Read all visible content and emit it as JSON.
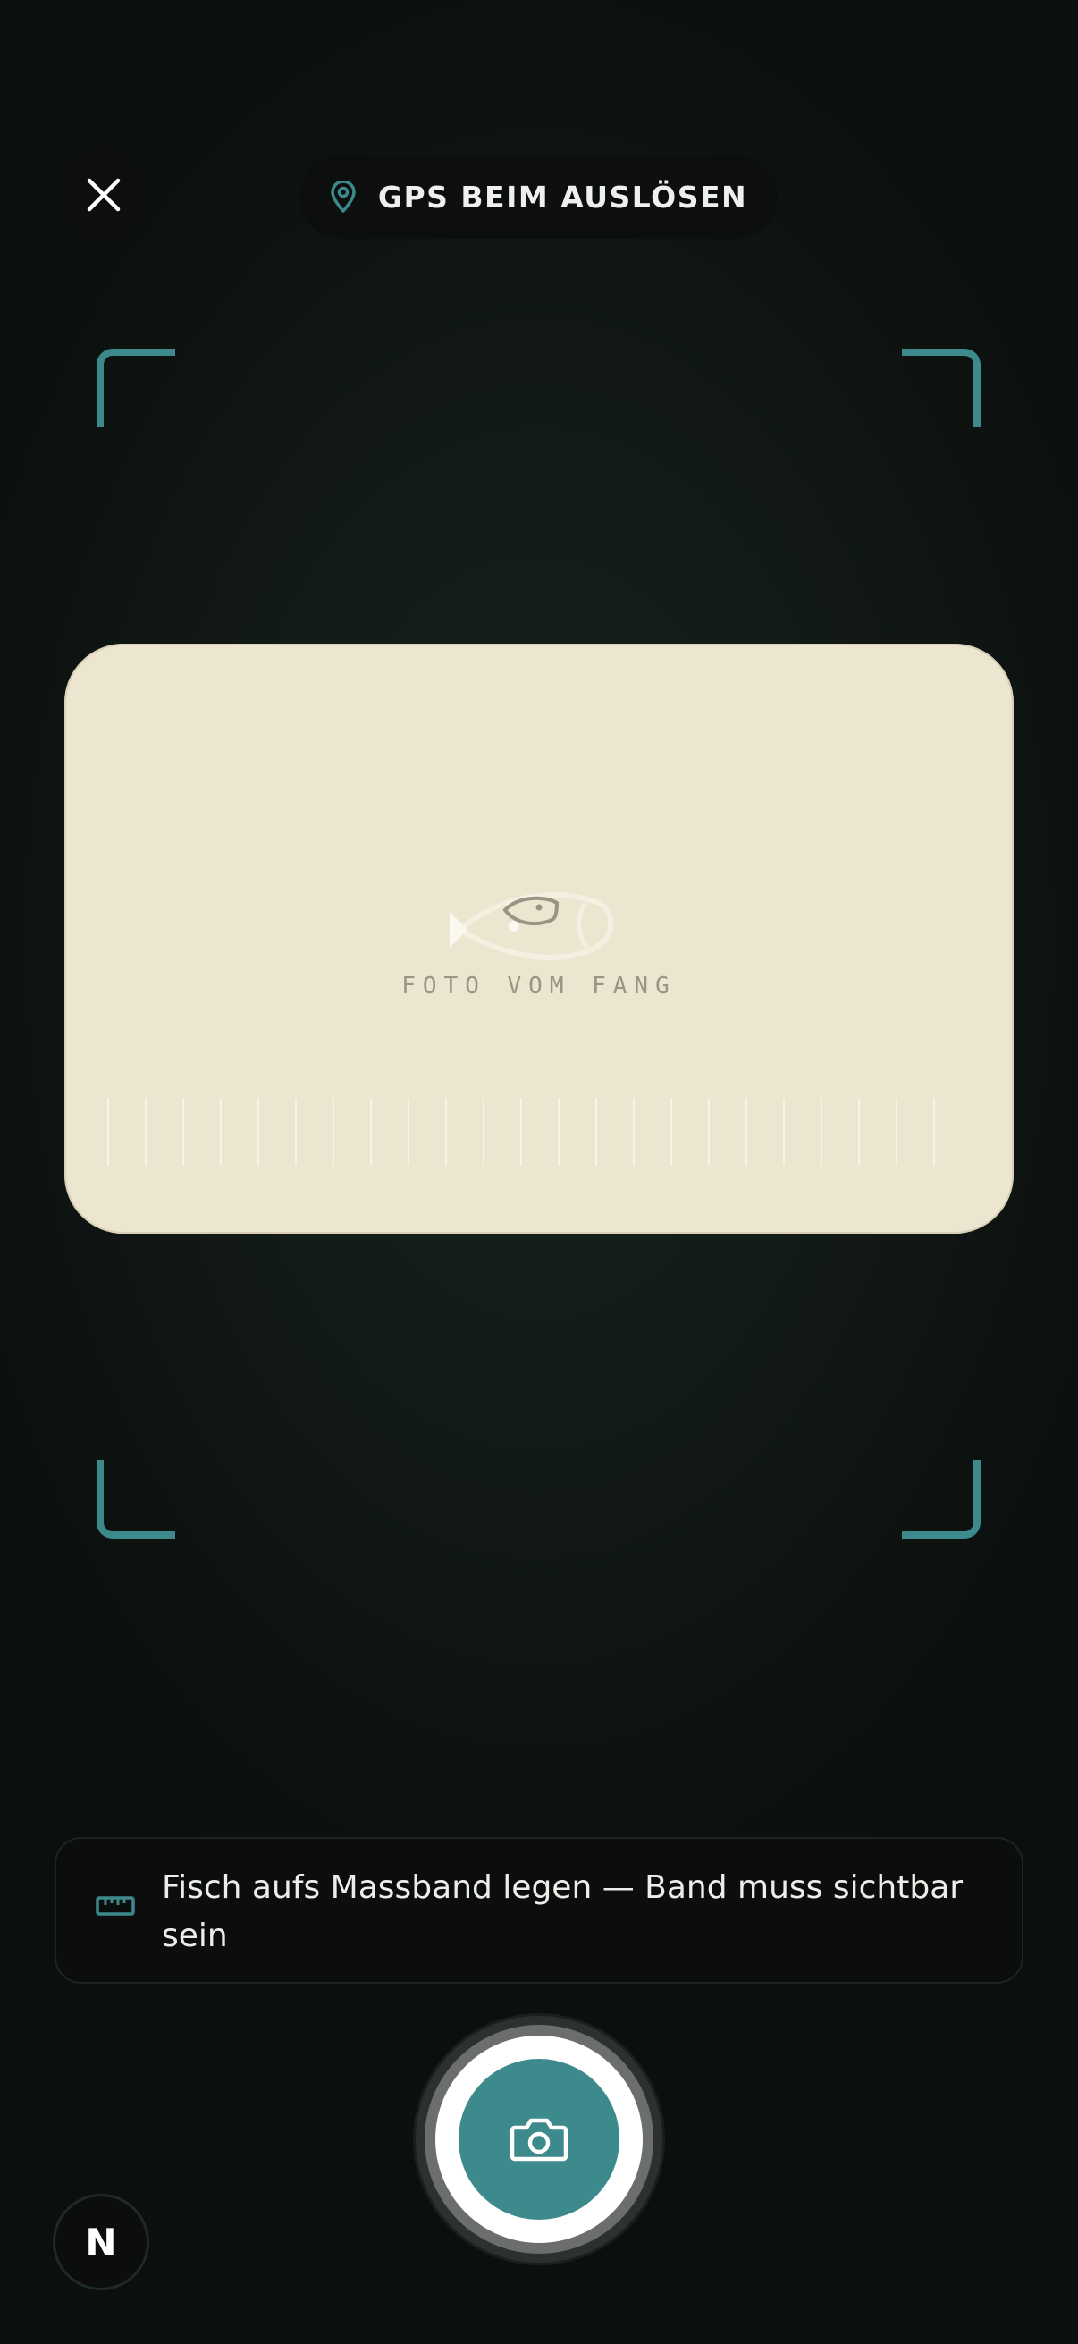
{
  "header": {
    "close_icon": "close-icon",
    "gps_icon": "map-pin-icon",
    "gps_label": "GPS BEIM AUSLÖSEN"
  },
  "viewfinder": {
    "placeholder_icon": "fish-icon",
    "placeholder_label": "FOTO VOM FANG"
  },
  "hint": {
    "icon": "ruler-icon",
    "text": "Fisch aufs Massband legen — Band muss sichtbar sein"
  },
  "shutter": {
    "icon": "camera-icon"
  },
  "badge": {
    "letter": "N"
  },
  "colors": {
    "accent": "#3d8a8d",
    "background": "#131b17",
    "card": "#ece5d0"
  }
}
